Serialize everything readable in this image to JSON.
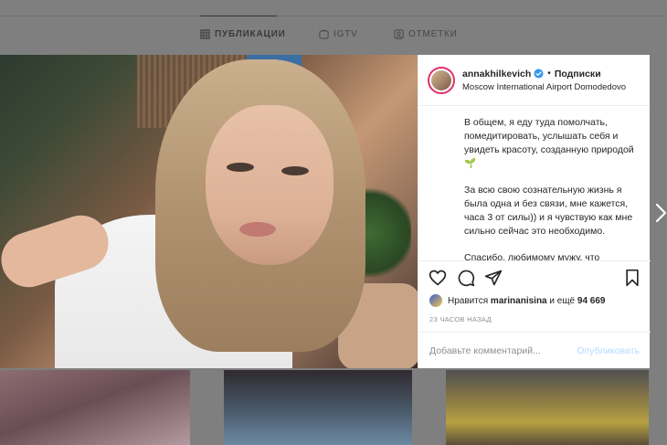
{
  "background": {
    "tabs": [
      {
        "label": "ПУБЛИКАЦИИ",
        "icon": "grid-icon"
      },
      {
        "label": "IGTV",
        "icon": "igtv-icon"
      },
      {
        "label": "ОТМЕТКИ",
        "icon": "tag-icon"
      }
    ]
  },
  "post": {
    "username": "annakhilkevich",
    "verified": true,
    "dot": "•",
    "follow_label": "Подписки",
    "location": "Moscow International Airport Domodedovo",
    "caption": {
      "p1": "В общем, я еду туда помолчать, помедитировать, услышать себя и увидеть красоту, созданную природой🌱",
      "p2": "За всю свою сознательную жизнь я была одна и без связи, мне кажется, часа 3 от силы)) и я чувствую как мне сильно сейчас это необходимо.",
      "p3": "Спасибо, любимому мужу, что",
      "p3_more": "..."
    },
    "likes": {
      "prefix": "Нравится",
      "user": "marinanisina",
      "middle": "и ещё",
      "count": "94 669"
    },
    "time_ago": "23 ЧАСОВ НАЗАД",
    "comment_placeholder": "Добавьте комментарий...",
    "publish_label": "Опубликовать"
  },
  "colors": {
    "accent_blue": "#3897f0",
    "publish_disabled": "#b3dbff",
    "story_ring": "#e1306c"
  }
}
